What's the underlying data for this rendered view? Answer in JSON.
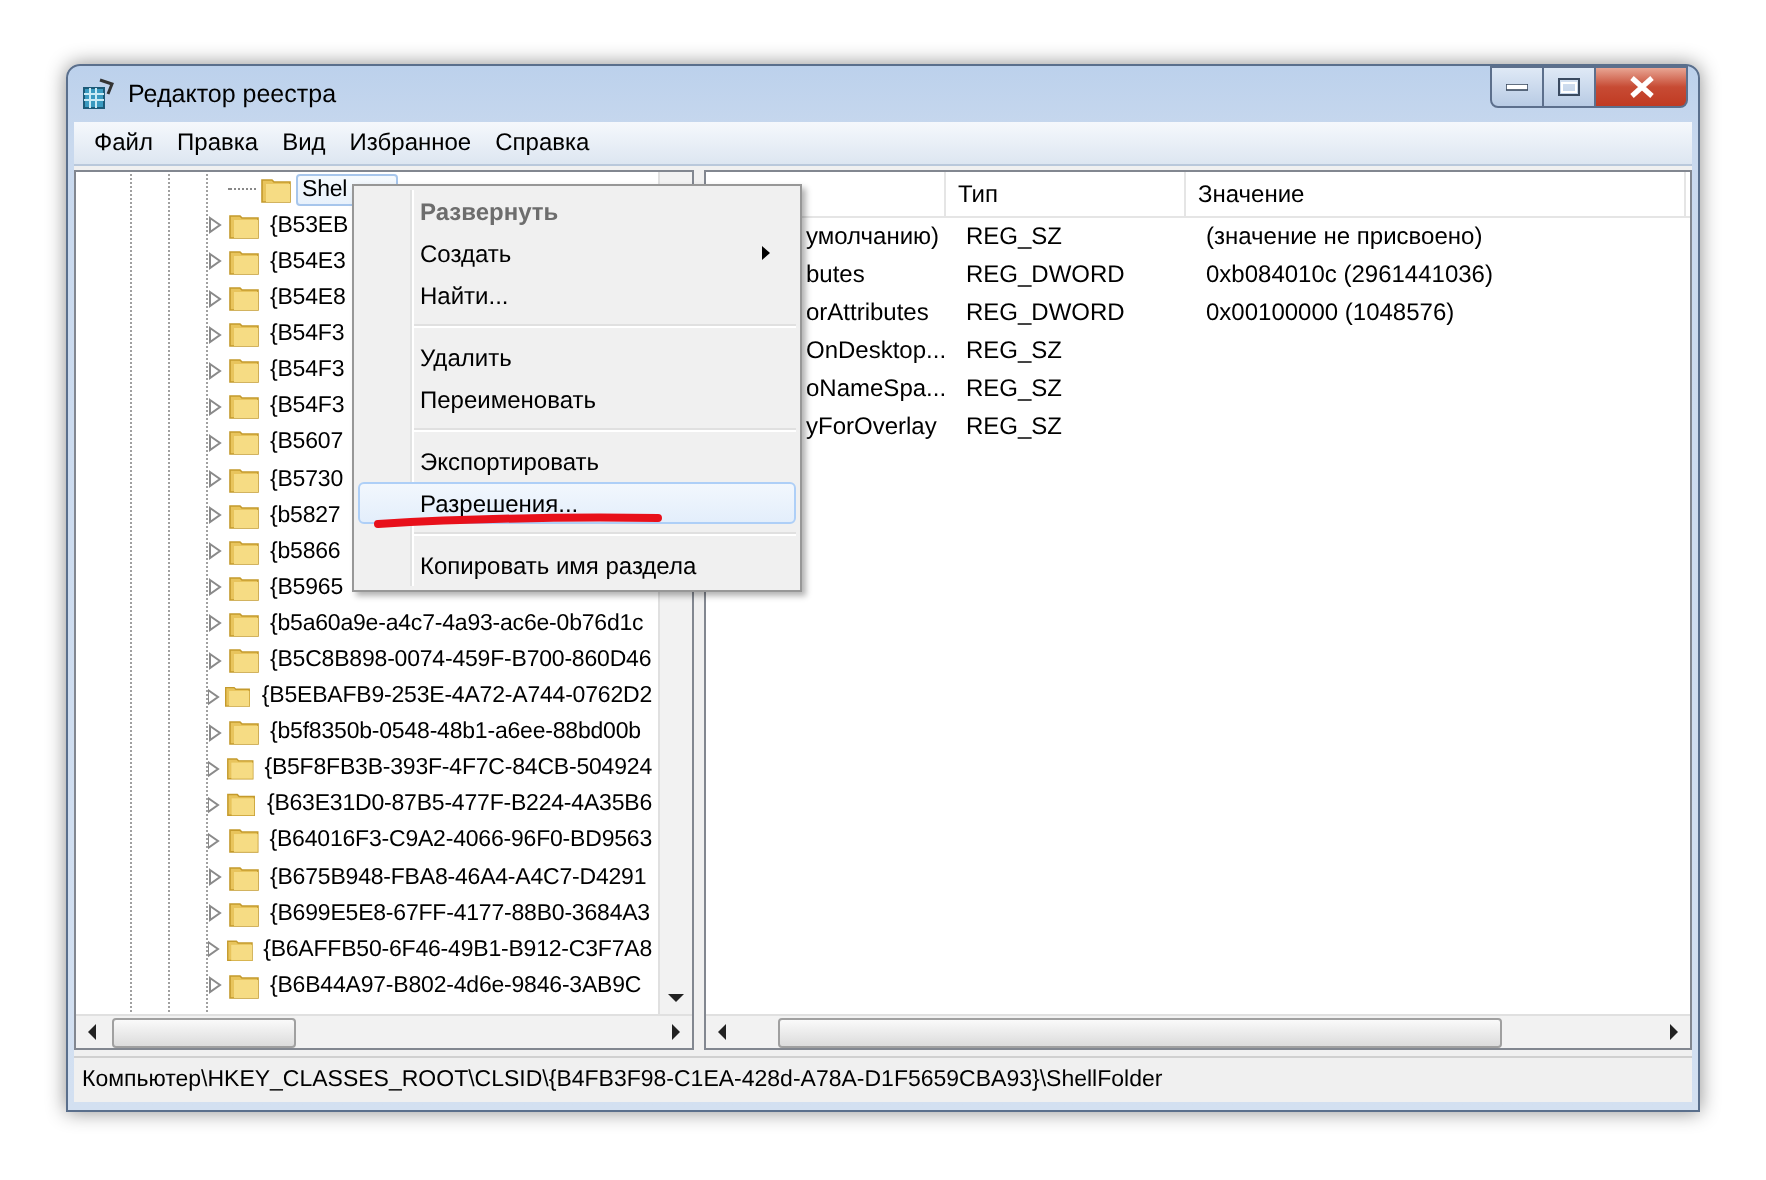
{
  "window": {
    "title": "Редактор реестра"
  },
  "menu_bar": [
    "Файл",
    "Правка",
    "Вид",
    "Избранное",
    "Справка"
  ],
  "tree": {
    "items": [
      {
        "label": "Shel",
        "selected": true,
        "expandable": false
      },
      {
        "label": "{B53EB",
        "selected": false,
        "expandable": true
      },
      {
        "label": "{B54E3",
        "selected": false,
        "expandable": true
      },
      {
        "label": "{B54E8",
        "selected": false,
        "expandable": true
      },
      {
        "label": "{B54F3",
        "selected": false,
        "expandable": true
      },
      {
        "label": "{B54F3",
        "selected": false,
        "expandable": true
      },
      {
        "label": "{B54F3",
        "selected": false,
        "expandable": true
      },
      {
        "label": "{B5607",
        "selected": false,
        "expandable": true
      },
      {
        "label": "{B5730",
        "selected": false,
        "expandable": true
      },
      {
        "label": "{b5827",
        "selected": false,
        "expandable": true
      },
      {
        "label": "{b5866",
        "selected": false,
        "expandable": true
      },
      {
        "label": "{B5965",
        "selected": false,
        "expandable": true
      },
      {
        "label": "{b5a60a9e-a4c7-4a93-ac6e-0b76d1c",
        "selected": false,
        "expandable": true
      },
      {
        "label": "{B5C8B898-0074-459F-B700-860D46",
        "selected": false,
        "expandable": true
      },
      {
        "label": "{B5EBAFB9-253E-4A72-A744-0762D2",
        "selected": false,
        "expandable": true
      },
      {
        "label": "{b5f8350b-0548-48b1-a6ee-88bd00b",
        "selected": false,
        "expandable": true
      },
      {
        "label": "{B5F8FB3B-393F-4F7C-84CB-504924",
        "selected": false,
        "expandable": true
      },
      {
        "label": "{B63E31D0-87B5-477F-B224-4A35B6",
        "selected": false,
        "expandable": true
      },
      {
        "label": "{B64016F3-C9A2-4066-96F0-BD9563",
        "selected": false,
        "expandable": true
      },
      {
        "label": "{B675B948-FBA8-46A4-A4C7-D4291",
        "selected": false,
        "expandable": true
      },
      {
        "label": "{B699E5E8-67FF-4177-88B0-3684A3",
        "selected": false,
        "expandable": true
      },
      {
        "label": "{B6AFFB50-6F46-49B1-B912-C3F7A8",
        "selected": false,
        "expandable": true
      },
      {
        "label": "{B6B44A97-B802-4d6e-9846-3AB9C",
        "selected": false,
        "expandable": true
      }
    ]
  },
  "values_table": {
    "columns": [
      "Тип",
      "Значение"
    ],
    "rows": [
      {
        "name": "умолчанию)",
        "type": "REG_SZ",
        "data": "(значение не присвоено)"
      },
      {
        "name": "butes",
        "type": "REG_DWORD",
        "data": "0xb084010c (2961441036)"
      },
      {
        "name": "orAttributes",
        "type": "REG_DWORD",
        "data": "0x00100000 (1048576)"
      },
      {
        "name": "OnDesktop...",
        "type": "REG_SZ"
      },
      {
        "name": "oNameSpa...",
        "type": "REG_SZ"
      },
      {
        "name": "yForOverlay",
        "type": "REG_SZ"
      }
    ]
  },
  "context_menu": {
    "items": [
      {
        "kind": "item",
        "label": "Развернуть",
        "default": true,
        "submenu": false,
        "highlighted": false
      },
      {
        "kind": "item",
        "label": "Создать",
        "default": false,
        "submenu": true,
        "highlighted": false
      },
      {
        "kind": "item",
        "label": "Найти...",
        "default": false,
        "submenu": false,
        "highlighted": false
      },
      {
        "kind": "separator"
      },
      {
        "kind": "item",
        "label": "Удалить",
        "default": false,
        "submenu": false,
        "highlighted": false
      },
      {
        "kind": "item",
        "label": "Переименовать",
        "default": false,
        "submenu": false,
        "highlighted": false
      },
      {
        "kind": "separator"
      },
      {
        "kind": "item",
        "label": "Экспортировать",
        "default": false,
        "submenu": false,
        "highlighted": false
      },
      {
        "kind": "item",
        "label": "Разрешения...",
        "default": false,
        "submenu": false,
        "highlighted": true
      },
      {
        "kind": "separator"
      },
      {
        "kind": "item",
        "label": "Копировать имя раздела",
        "default": false,
        "submenu": false,
        "highlighted": false
      }
    ]
  },
  "status_bar": "Компьютер\\HKEY_CLASSES_ROOT\\CLSID\\{B4FB3F98-C1EA-428d-A78A-D1F5659CBA93}\\ShellFolder"
}
